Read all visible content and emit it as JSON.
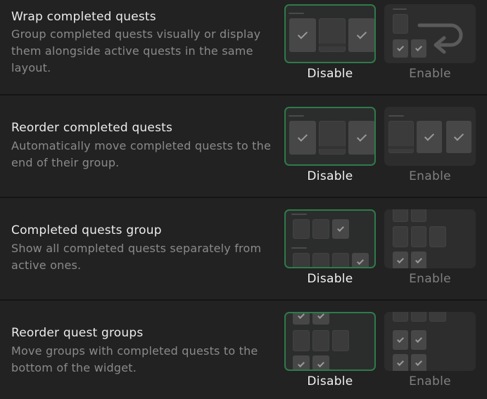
{
  "sections": [
    {
      "title": "Wrap completed quests",
      "description": "Group completed quests visually or display them alongside active quests in the same layout.",
      "options": [
        {
          "label": "Disable",
          "selected": true
        },
        {
          "label": "Enable",
          "selected": false
        }
      ]
    },
    {
      "title": "Reorder completed quests",
      "description": "Automatically move completed quests to the end of their group.",
      "options": [
        {
          "label": "Disable",
          "selected": true
        },
        {
          "label": "Enable",
          "selected": false
        }
      ]
    },
    {
      "title": "Completed quests group",
      "description": "Show all completed quests separately from active ones.",
      "options": [
        {
          "label": "Disable",
          "selected": true
        },
        {
          "label": "Enable",
          "selected": false
        }
      ]
    },
    {
      "title": "Reorder quest groups",
      "description": "Move groups with completed quests to the bottom of the widget.",
      "options": [
        {
          "label": "Disable",
          "selected": true
        },
        {
          "label": "Enable",
          "selected": false
        }
      ]
    }
  ],
  "colors": {
    "background": "#222222",
    "selected_border": "#2f7a4b",
    "title_text": "#ececec",
    "description_text": "#8a8a8a"
  }
}
